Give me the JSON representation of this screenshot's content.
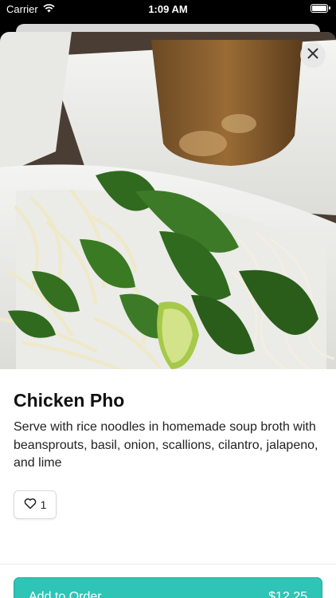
{
  "status_bar": {
    "carrier": "Carrier",
    "time": "1:09 AM",
    "battery_level": 1.0
  },
  "item": {
    "title": "Chicken Pho",
    "description": "Serve with rice noodles in homemade soup broth with beansprouts, basil, onion, scallions, cilantro, jalapeno, and lime",
    "likes": "1"
  },
  "actions": {
    "add_label": "Add to Order",
    "price": "$12.25"
  },
  "icons": {
    "close": "close-icon",
    "like": "heart-outline-icon",
    "wifi": "wifi-icon",
    "battery": "battery-icon"
  },
  "colors": {
    "accent": "#2ec4b6",
    "accent_border": "#26a99c",
    "text_primary": "#111111"
  }
}
